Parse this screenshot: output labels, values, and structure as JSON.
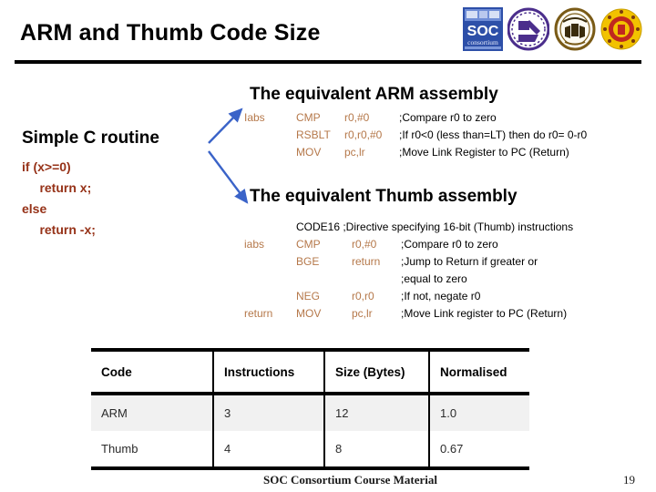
{
  "slide": {
    "title": "ARM and Thumb Code Size",
    "accent_arrow_color": "#3a63c8",
    "code_color": "#963218",
    "asm_color": "#B5784A",
    "rule_color": "#000000"
  },
  "logos": [
    {
      "name": "soc-consortium-logo",
      "label": "SOC consortium"
    },
    {
      "name": "nctu-logo",
      "label": "university seal purple"
    },
    {
      "name": "ntu-logo",
      "label": "university seal brown"
    },
    {
      "name": "nthu-logo",
      "label": "university seal yellow"
    }
  ],
  "c_routine": {
    "heading": "Simple C routine",
    "lines": [
      "if (x>=0)",
      "     return x;",
      "else",
      "     return -x;"
    ]
  },
  "arm_section": {
    "heading": "The equivalent ARM assembly",
    "rows": [
      {
        "label": "Iabs",
        "mnemonic": "CMP",
        "operands": "r0,#0",
        "comment": ";Compare r0 to zero"
      },
      {
        "label": "",
        "mnemonic": "RSBLT",
        "operands": "r0,r0,#0",
        "comment": ";If r0<0 (less than=LT) then do r0= 0-r0"
      },
      {
        "label": "",
        "mnemonic": "MOV",
        "operands": "pc,lr",
        "comment": ";Move Link Register to PC (Return)"
      }
    ]
  },
  "thumb_section": {
    "heading": "The equivalent Thumb assembly",
    "directive_row": {
      "label": "",
      "directive": "CODE16 ;Directive specifying 16-bit (Thumb) instructions"
    },
    "rows": [
      {
        "label": "iabs",
        "mnemonic": "CMP",
        "operands": "r0,#0",
        "comment": ";Compare r0 to zero"
      },
      {
        "label": "",
        "mnemonic": "BGE",
        "operands": "return",
        "comment": ";Jump to Return if greater or"
      },
      {
        "label": "",
        "mnemonic": "",
        "operands": "",
        "comment": ";equal to zero"
      },
      {
        "label": "",
        "mnemonic": "NEG",
        "operands": "r0,r0",
        "comment": ";If not, negate r0"
      },
      {
        "label": "return",
        "mnemonic": "MOV",
        "operands": "pc,lr",
        "comment": ";Move Link register to PC (Return)"
      }
    ]
  },
  "table": {
    "headers": [
      "Code",
      "Instructions",
      "Size (Bytes)",
      "Normalised"
    ],
    "rows": [
      {
        "code": "ARM",
        "instructions": "3",
        "size": "12",
        "normalised": "1.0"
      },
      {
        "code": "Thumb",
        "instructions": "4",
        "size": "8",
        "normalised": "0.67"
      }
    ]
  },
  "footer": {
    "text": "SOC Consortium Course Material",
    "page": "19"
  }
}
